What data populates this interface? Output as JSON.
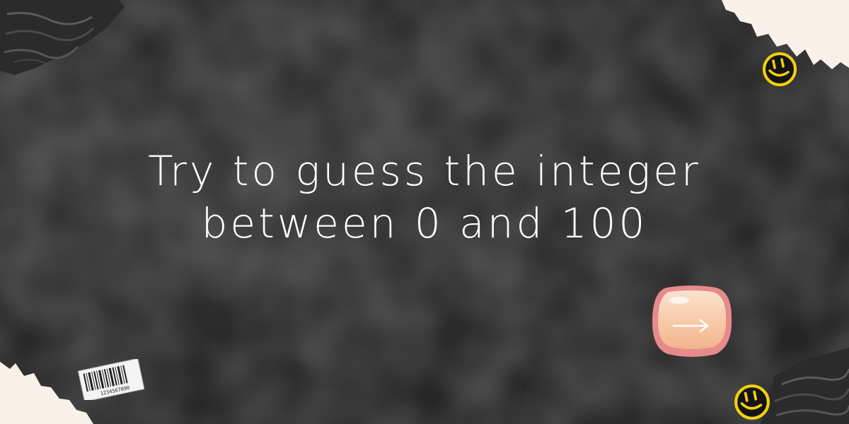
{
  "headline": {
    "line1": "Try to guess the integer",
    "line2": "between 0 and 100"
  },
  "next_button": {
    "icon": "arrow-right-icon",
    "arrow_glyph": "→"
  },
  "barcode": {
    "number": "1234567890"
  },
  "decorations": {
    "smiley_icon": "smiley-face-icon",
    "smiley_color": "#f2d10c",
    "background_color": "#1b1b1b",
    "paper_color": "#f7f1ea",
    "button_fill": "#f7c9a6",
    "button_border": "#e07f82"
  }
}
